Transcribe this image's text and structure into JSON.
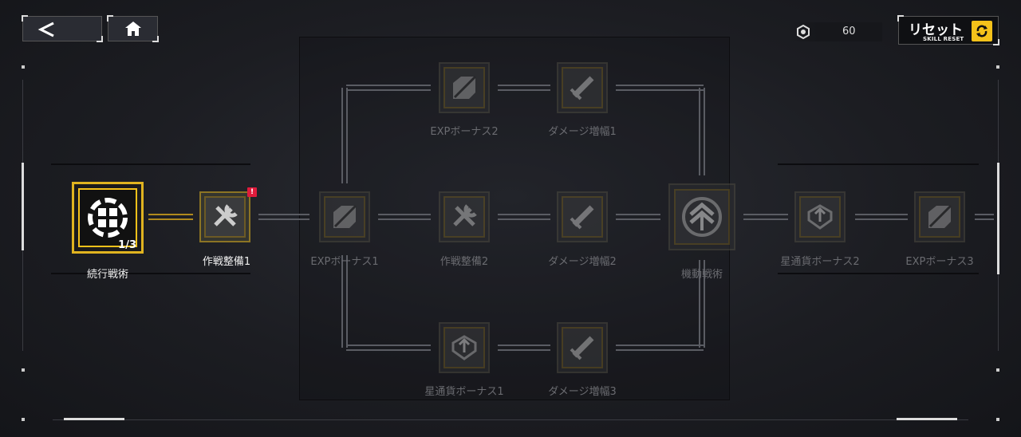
{
  "header": {
    "back_label": "back",
    "home_label": "home",
    "currency_value": "60",
    "reset_label": "リセット",
    "reset_sublabel": "SKILL RESET"
  },
  "nodes": {
    "start": {
      "label": "続行戦術",
      "level": "1/3"
    },
    "n1": {
      "label": "作戦整備1",
      "badge": "!"
    },
    "n2": {
      "label": "EXPボーナス1"
    },
    "n3": {
      "label": "作戦整備2"
    },
    "n4": {
      "label": "ダメージ増幅2"
    },
    "hub": {
      "label": "機動戦術"
    },
    "n6": {
      "label": "星通貨ボーナス2"
    },
    "n7": {
      "label": "EXPボーナス3"
    },
    "top1": {
      "label": "EXPボーナス2"
    },
    "top2": {
      "label": "ダメージ増幅1"
    },
    "bot1": {
      "label": "星通貨ボーナス1"
    },
    "bot2": {
      "label": "ダメージ増幅3"
    }
  },
  "colors": {
    "accent": "#f5c21a",
    "badge": "#e01b3c",
    "dim_text": "#6a6b70"
  }
}
